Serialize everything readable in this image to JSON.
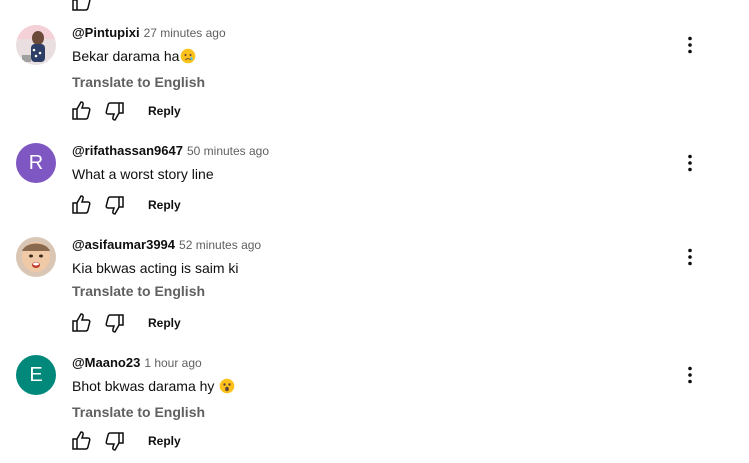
{
  "colors": {
    "avatar_r": "#7e57c2",
    "avatar_e": "#00897b",
    "text_primary": "#0f0f0f",
    "text_secondary": "#606060"
  },
  "icons": {
    "like": "thumbs-up-icon",
    "dislike": "thumbs-down-icon",
    "more": "more-vertical-icon"
  },
  "comments": [
    {
      "author": "@Pintupixi",
      "time": "27 minutes ago",
      "text": "Bekar darama ha",
      "emoji": "crying-face-emoji",
      "translate": "Translate to English",
      "reply": "Reply",
      "avatar_type": "photo"
    },
    {
      "author": "@rifathassan9647",
      "time": "50 minutes ago",
      "text": "What a worst story line",
      "reply": "Reply",
      "avatar_letter": "R"
    },
    {
      "author": "@asifaumar3994",
      "time": "52 minutes ago",
      "text": "Kia bkwas acting is saim ki",
      "translate": "Translate to English",
      "reply": "Reply",
      "avatar_type": "photo"
    },
    {
      "author": "@Maano23",
      "time": "1 hour ago",
      "text": "Bhot bkwas darama hy",
      "emoji": "astonished-face-emoji",
      "translate": "Translate to English",
      "reply": "Reply",
      "avatar_letter": "E"
    }
  ]
}
